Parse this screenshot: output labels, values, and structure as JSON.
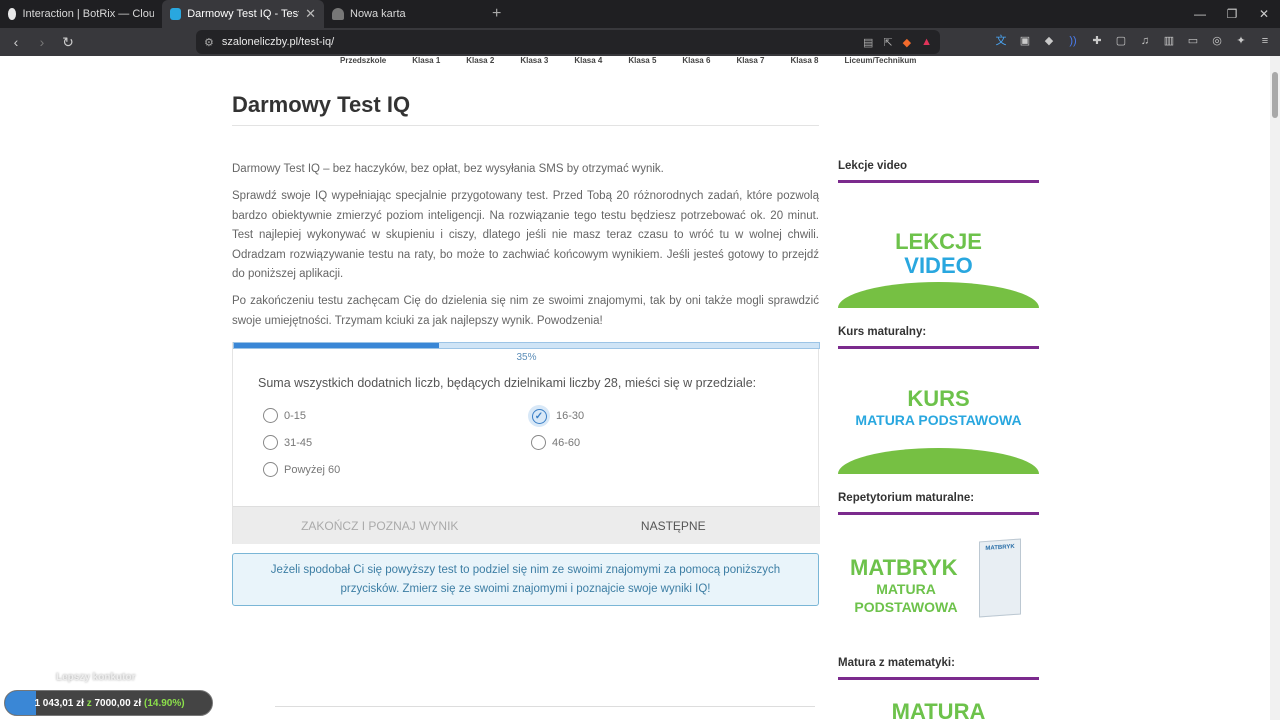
{
  "browser": {
    "tabs": [
      {
        "title": "Interaction | BotRix — Cloud Stream...",
        "active": false
      },
      {
        "title": "Darmowy Test IQ - Testy",
        "active": true
      },
      {
        "title": "Nowa karta",
        "active": false
      }
    ],
    "url": "szaloneliczby.pl/test-iq/"
  },
  "site_nav": [
    "Przedszkole",
    "Klasa 1",
    "Klasa 2",
    "Klasa 3",
    "Klasa 4",
    "Klasa 5",
    "Klasa 6",
    "Klasa 7",
    "Klasa 8",
    "Liceum/Technikum"
  ],
  "page": {
    "title": "Darmowy Test IQ",
    "paragraphs": [
      "Darmowy Test IQ – bez haczyków, bez opłat, bez wysyłania SMS by otrzymać wynik.",
      "Sprawdź swoje IQ wypełniając specjalnie przygotowany test. Przed Tobą 20 różnorodnych zadań, które pozwolą bardzo obiektywnie zmierzyć poziom inteligencji. Na rozwiązanie tego testu będziesz potrzebować ok. 20 minut. Test najlepiej wykonywać w skupieniu i ciszy, dlatego jeśli nie masz teraz czasu to wróć tu w wolnej chwili. Odradzam rozwiązywanie testu na raty, bo może to zachwiać końcowym wynikiem. Jeśli jesteś gotowy to przejdź do poniższej aplikacji.",
      "Po zakończeniu testu zachęcam Cię do dzielenia się nim ze swoimi znajomymi, tak by oni także mogli sprawdzić swoje umiejętności. Trzymam kciuki za jak najlepszy wynik. Powodzenia!"
    ]
  },
  "quiz": {
    "progress_fraction": 0.35,
    "progress_label": "35%",
    "question": "Suma wszystkich dodatnich liczb, będących dzielnikami liczby 28, mieści się w przedziale:",
    "options": [
      {
        "label": "0-15",
        "selected": false
      },
      {
        "label": "16-30",
        "selected": true
      },
      {
        "label": "31-45",
        "selected": false
      },
      {
        "label": "46-60",
        "selected": false
      },
      {
        "label": "Powyżej 60",
        "selected": false
      }
    ],
    "finish_label": "ZAKOŃCZ I POZNAJ WYNIK",
    "next_label": "NASTĘPNE"
  },
  "share_text": "Jeżeli spodobał Ci się powyższy test to podziel się nim ze swoimi znajomymi za pomocą poniższych przycisków. Zmierz się ze swoimi znajomymi i poznajcie swoje wyniki IQ!",
  "sidebar": {
    "sections": [
      {
        "heading": "Lekcje video",
        "promo_line1": "LEKCJE",
        "promo_line2": "VIDEO"
      },
      {
        "heading": "Kurs maturalny:",
        "promo_line1": "KURS",
        "promo_line2": "MATURA PODSTAWOWA"
      },
      {
        "heading": "Repetytorium maturalne:",
        "promo_line1": "MATBRYK",
        "promo_line2": "MATURA",
        "promo_line3": "PODSTAWOWA",
        "book_label": "MATBRYK"
      },
      {
        "heading": "Matura z matematyki:",
        "promo_line1": "MATURA"
      }
    ]
  },
  "overlay_widget": {
    "label": "Lepszy konkutor",
    "amount": "1 043,01 zł",
    "sep": "z",
    "goal": "7000,00 zł",
    "percent": "(14.90%)",
    "fraction": 0.149
  },
  "colors": {
    "accent": "#3a87d6",
    "sidebar_rule": "#7b2a8d",
    "promo_green": "#6dc24b",
    "promo_blue": "#29a7df"
  }
}
